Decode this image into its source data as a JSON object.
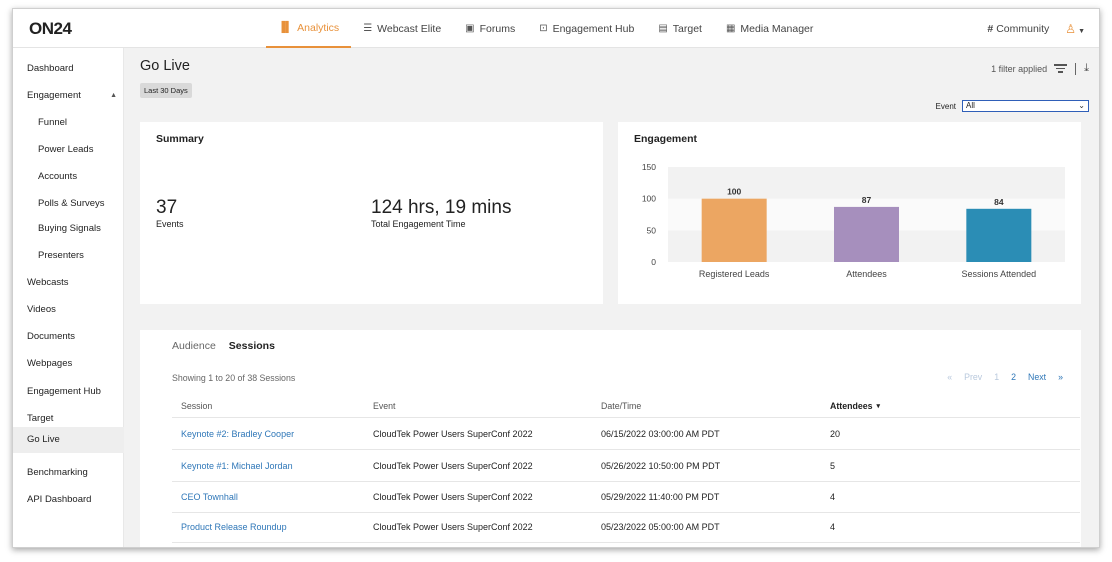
{
  "brand": {
    "logo": "ON24",
    "accent_color": "#e8913a",
    "link_color": "#2f77b8"
  },
  "topnav": {
    "items": [
      {
        "label": "Analytics",
        "icon": "bar-chart-icon",
        "active": true
      },
      {
        "label": "Webcast Elite",
        "icon": "list-icon"
      },
      {
        "label": "Forums",
        "icon": "forum-icon"
      },
      {
        "label": "Engagement Hub",
        "icon": "hub-icon"
      },
      {
        "label": "Target",
        "icon": "target-icon"
      },
      {
        "label": "Media Manager",
        "icon": "grid-icon"
      }
    ],
    "community": "Community",
    "user_icon": "user-icon"
  },
  "sidebar": {
    "items": [
      {
        "label": "Dashboard"
      },
      {
        "label": "Engagement",
        "expanded": true
      },
      {
        "label": "Funnel",
        "sub": true
      },
      {
        "label": "Power Leads",
        "sub": true
      },
      {
        "label": "Accounts",
        "sub": true
      },
      {
        "label": "Polls & Surveys",
        "sub": true
      },
      {
        "label": "Buying Signals",
        "sub": true
      },
      {
        "label": "Presenters",
        "sub": true
      },
      {
        "label": "Webcasts"
      },
      {
        "label": "Videos"
      },
      {
        "label": "Documents"
      },
      {
        "label": "Webpages"
      },
      {
        "label": "Engagement Hub"
      },
      {
        "label": "Target"
      },
      {
        "label": "Go Live",
        "active": true
      },
      {
        "label": "Benchmarking"
      },
      {
        "label": "API Dashboard"
      }
    ]
  },
  "page": {
    "title": "Go Live",
    "date_range": "Last 30 Days",
    "filter_text": "1 filter applied",
    "event_label": "Event",
    "event_value": "All"
  },
  "summary": {
    "title": "Summary",
    "events_value": "37",
    "events_label": "Events",
    "time_value": "124 hrs, 19 mins",
    "time_label": "Total Engagement Time"
  },
  "engagement": {
    "title": "Engagement"
  },
  "chart_data": {
    "type": "bar",
    "title": "Engagement",
    "categories": [
      "Registered Leads",
      "Attendees",
      "Sessions Attended"
    ],
    "values": [
      100,
      87,
      84
    ],
    "colors": [
      "#eca662",
      "#a68fbd",
      "#2b8db5"
    ],
    "ylim": [
      0,
      150
    ],
    "yticks": [
      0,
      50,
      100,
      150
    ],
    "data_labels": true,
    "grid": "alternating bands"
  },
  "sessions": {
    "tabs": [
      "Audience",
      "Sessions"
    ],
    "active_tab": "Sessions",
    "showing": "Showing 1 to 20 of 38 Sessions",
    "pager": {
      "first": "«",
      "prev": "Prev",
      "page1": "1",
      "page2": "2",
      "next": "Next",
      "last": "»"
    },
    "columns": [
      "Session",
      "Event",
      "Date/Time",
      "Attendees"
    ],
    "sort_indicator": "▾",
    "rows": [
      {
        "session": "Keynote #2:  Bradley Cooper",
        "event": "CloudTek Power Users SuperConf 2022",
        "datetime": "06/15/2022 03:00:00 AM PDT",
        "attendees": "20"
      },
      {
        "session": "Keynote #1: Michael Jordan",
        "event": "CloudTek Power Users SuperConf 2022",
        "datetime": "05/26/2022 10:50:00 PM PDT",
        "attendees": "5"
      },
      {
        "session": "CEO Townhall",
        "event": "CloudTek Power Users SuperConf 2022",
        "datetime": "05/29/2022 11:40:00 PM PDT",
        "attendees": "4"
      },
      {
        "session": "Product Release Roundup",
        "event": "CloudTek Power Users SuperConf 2022",
        "datetime": "05/23/2022 05:00:00 AM PDT",
        "attendees": "4"
      }
    ]
  }
}
